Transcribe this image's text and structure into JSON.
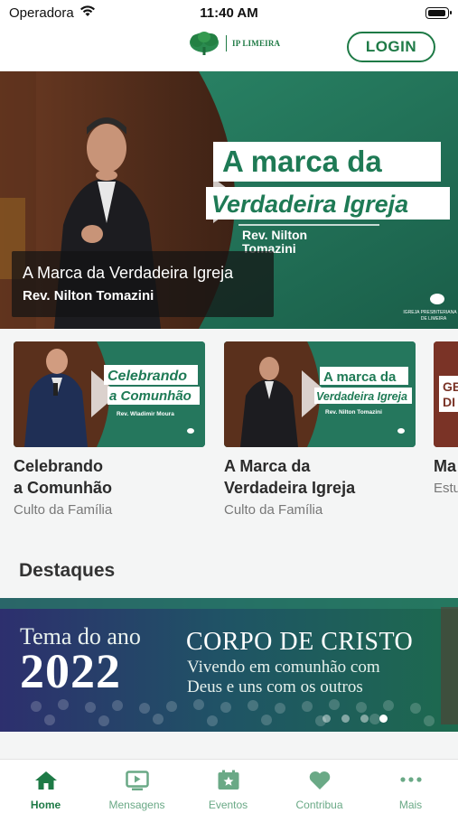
{
  "status_bar": {
    "carrier": "Operadora",
    "time": "11:40 AM"
  },
  "header": {
    "logo_text": "IP LIMEIRA",
    "login_label": "LOGIN"
  },
  "hero": {
    "title_line1": "A marca da",
    "title_line2": "Verdadeira Igreja",
    "speaker_line1": "Rev. Nilton",
    "speaker_line2": "Tomazini",
    "church_mark": "IGREJA PRESBITERIANA DE LIMEIRA",
    "caption_title": "A Marca da Verdadeira Igreja",
    "caption_subtitle": "Rev. Nilton Tomazini"
  },
  "videos": [
    {
      "title": "Celebrando\na Comunhão",
      "category": "Culto da Família",
      "thumb_line1": "Celebrando",
      "thumb_line2": "a Comunhão",
      "thumb_speaker": "Rev. Wladimir Moura"
    },
    {
      "title": "A Marca da\nVerdadeira Igreja",
      "category": "Culto da Família",
      "thumb_line1": "A marca da",
      "thumb_line2": "Verdadeira Igreja",
      "thumb_speaker": "Rev. Nilton Tomazini"
    },
    {
      "title": "Ma",
      "category": "Estu",
      "thumb_line1": "GE",
      "thumb_line2": "DI"
    }
  ],
  "destaques": {
    "section_title": "Destaques",
    "banner_tema": "Tema do ano",
    "banner_year": "2022",
    "banner_title": "CORPO DE CRISTO",
    "banner_sub1": "Vivendo em comunhão com",
    "banner_sub2": "Deus e uns com os outros",
    "dots_total": 4,
    "active_dot": 4
  },
  "tabbar": {
    "tabs": [
      {
        "label": "Home",
        "icon": "home-icon",
        "active": true
      },
      {
        "label": "Mensagens",
        "icon": "video-icon",
        "active": false
      },
      {
        "label": "Eventos",
        "icon": "calendar-star-icon",
        "active": false
      },
      {
        "label": "Contribua",
        "icon": "heart-icon",
        "active": false
      },
      {
        "label": "Mais",
        "icon": "more-dots-icon",
        "active": false
      }
    ]
  },
  "colors": {
    "brand_green": "#1e7a46",
    "hero_teal": "#1e6b53",
    "inactive_tab": "#6aa986"
  }
}
